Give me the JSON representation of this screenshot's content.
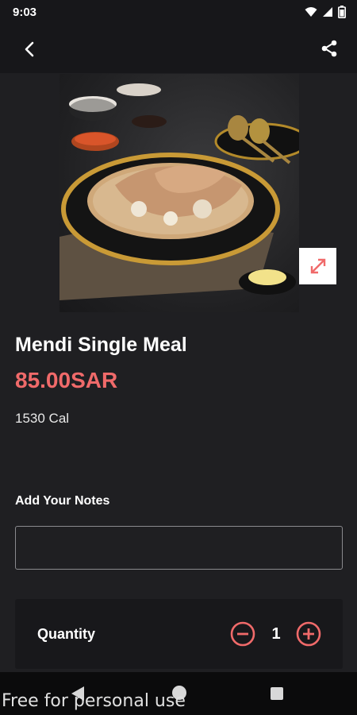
{
  "status": {
    "time": "9:03"
  },
  "icons": {
    "back": "back-arrow-icon",
    "share": "share-icon",
    "expand": "expand-icon",
    "minus": "minus-circle-icon",
    "plus": "plus-circle-icon",
    "wifi": "wifi-icon",
    "signal": "signal-icon",
    "battery": "battery-icon"
  },
  "product": {
    "name": "Mendi Single Meal",
    "price": "85.00SAR",
    "calories": "1530 Cal"
  },
  "notes": {
    "label": "Add Your Notes",
    "value": ""
  },
  "quantity": {
    "label": "Quantity",
    "value": "1"
  },
  "watermark": "Free for personal use",
  "colors": {
    "accent": "#f06a6a",
    "background": "#1f1f22",
    "bar": "#17171a"
  }
}
